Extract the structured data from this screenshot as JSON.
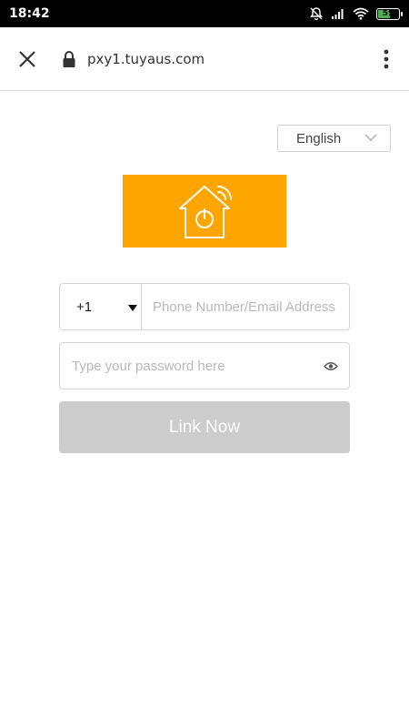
{
  "status_bar": {
    "time": "18:42",
    "battery_level": "59",
    "icons": [
      "alarm-off-icon",
      "signal-icon",
      "wifi-icon",
      "battery-icon"
    ]
  },
  "browser": {
    "url": "pxy1.tuyaus.com",
    "icons": [
      "close-icon",
      "lock-icon",
      "more-vert-icon"
    ]
  },
  "language": {
    "selected": "English"
  },
  "logo": {
    "icon": "smart-home-power-icon",
    "background": "#ffa500"
  },
  "form": {
    "country_code": "+1",
    "account_placeholder": "Phone Number/Email Address",
    "password_placeholder": "Type your password here",
    "submit_label": "Link Now",
    "submit_color": "#cccccc"
  }
}
